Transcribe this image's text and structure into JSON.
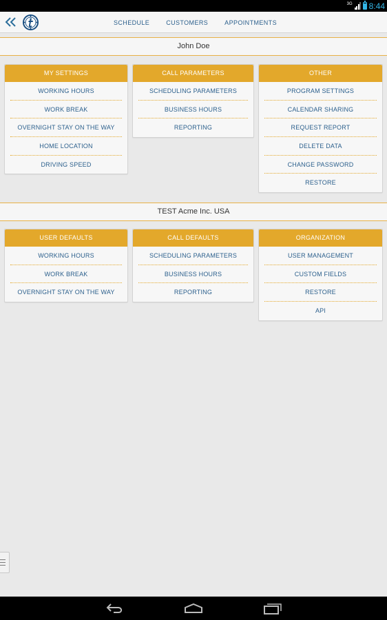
{
  "status_bar": {
    "network": "3G",
    "time": "8:44"
  },
  "nav_tabs": [
    {
      "label": "SCHEDULE"
    },
    {
      "label": "CUSTOMERS"
    },
    {
      "label": "APPOINTMENTS"
    }
  ],
  "sections": [
    {
      "title": "John Doe",
      "cards": [
        {
          "header": "MY SETTINGS",
          "items": [
            "WORKING HOURS",
            "WORK BREAK",
            "OVERNIGHT STAY ON THE WAY",
            "HOME LOCATION",
            "DRIVING SPEED"
          ]
        },
        {
          "header": "CALL PARAMETERS",
          "items": [
            "SCHEDULING PARAMETERS",
            "BUSINESS HOURS",
            "REPORTING"
          ]
        },
        {
          "header": "OTHER",
          "items": [
            "PROGRAM SETTINGS",
            "CALENDAR SHARING",
            "REQUEST REPORT",
            "DELETE DATA",
            "CHANGE PASSWORD",
            "RESTORE"
          ]
        }
      ]
    },
    {
      "title": "TEST Acme Inc. USA",
      "cards": [
        {
          "header": "USER DEFAULTS",
          "items": [
            "WORKING HOURS",
            "WORK BREAK",
            "OVERNIGHT STAY ON THE WAY"
          ]
        },
        {
          "header": "CALL DEFAULTS",
          "items": [
            "SCHEDULING PARAMETERS",
            "BUSINESS HOURS",
            "REPORTING"
          ]
        },
        {
          "header": "ORGANIZATION",
          "items": [
            "USER MANAGEMENT",
            "CUSTOM FIELDS",
            "RESTORE",
            "API"
          ]
        }
      ]
    }
  ],
  "colors": {
    "accent": "#e3a82b",
    "link": "#2b5f8c",
    "status_accent": "#33b5e5",
    "background": "#e9e9e9"
  },
  "icons": {
    "back": "double-chevron-left-icon",
    "logo": "app-logo-icon",
    "drawer": "menu-handle-icon",
    "nav_back": "back-arrow-icon",
    "nav_home": "home-icon",
    "nav_recents": "recent-apps-icon"
  }
}
